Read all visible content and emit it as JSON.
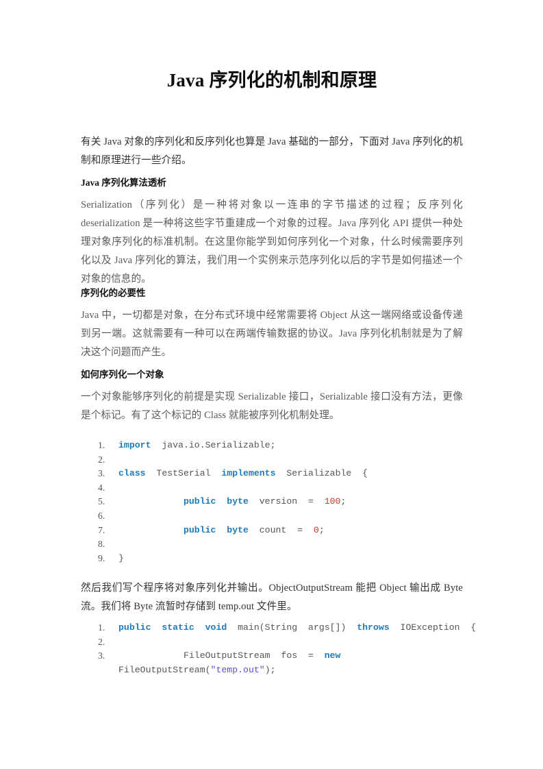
{
  "document": {
    "title": "Java 序列化的机制和原理",
    "intro": "有关 Java 对象的序列化和反序列化也算是 Java 基础的一部分，下面对 Java 序列化的机制和原理进行一些介绍。",
    "sections": [
      {
        "heading": "Java 序列化算法透析",
        "body": "Serialization（序列化）是一种将对象以一连串的字节描述的过程；反序列化 deserialization 是一种将这些字节重建成一个对象的过程。Java 序列化 API 提供一种处理对象序列化的标准机制。在这里你能学到如何序列化一个对象，什么时候需要序列化以及 Java 序列化的算法，我们用一个实例来示范序列化以后的字节是如何描述一个对象的信息的。"
      },
      {
        "heading": "序列化的必要性",
        "body": "Java 中，一切都是对象，在分布式环境中经常需要将 Object 从这一端网络或设备传递到另一端。这就需要有一种可以在两端传输数据的协议。Java 序列化机制就是为了解决这个问题而产生。"
      },
      {
        "heading": "如何序列化一个对象",
        "body": "一个对象能够序列化的前提是实现 Serializable 接口，Serializable 接口没有方法，更像是个标记。有了这个标记的 Class 就能被序列化机制处理。"
      }
    ],
    "paragraph_after_code1": "然后我们写个程序将对象序列化并输出。ObjectOutputStream 能把 Object 输出成 Byte 流。我们将 Byte 流暂时存储到 temp.out 文件里。",
    "code_block_1": {
      "language": "java",
      "lines": [
        {
          "number": 1,
          "tokens": [
            {
              "t": "import",
              "c": "kw"
            },
            {
              "t": "  java.io.Serializable;",
              "c": "plain"
            }
          ]
        },
        {
          "number": 2,
          "tokens": []
        },
        {
          "number": 3,
          "tokens": [
            {
              "t": "class",
              "c": "kw"
            },
            {
              "t": "  TestSerial  ",
              "c": "plain"
            },
            {
              "t": "implements",
              "c": "kw"
            },
            {
              "t": "  Serializable  {",
              "c": "plain"
            }
          ]
        },
        {
          "number": 4,
          "tokens": []
        },
        {
          "number": 5,
          "tokens": [
            {
              "t": "            ",
              "c": "plain"
            },
            {
              "t": "public",
              "c": "kw"
            },
            {
              "t": "  ",
              "c": "plain"
            },
            {
              "t": "byte",
              "c": "kw"
            },
            {
              "t": "  version  =  ",
              "c": "plain"
            },
            {
              "t": "100",
              "c": "num"
            },
            {
              "t": ";",
              "c": "plain"
            }
          ]
        },
        {
          "number": 6,
          "tokens": []
        },
        {
          "number": 7,
          "tokens": [
            {
              "t": "            ",
              "c": "plain"
            },
            {
              "t": "public",
              "c": "kw"
            },
            {
              "t": "  ",
              "c": "plain"
            },
            {
              "t": "byte",
              "c": "kw"
            },
            {
              "t": "  count  =  ",
              "c": "plain"
            },
            {
              "t": "0",
              "c": "num"
            },
            {
              "t": ";",
              "c": "plain"
            }
          ]
        },
        {
          "number": 8,
          "tokens": []
        },
        {
          "number": 9,
          "tokens": [
            {
              "t": "}",
              "c": "plain"
            }
          ]
        }
      ]
    },
    "code_block_2": {
      "language": "java",
      "lines": [
        {
          "number": 1,
          "tokens": [
            {
              "t": "public",
              "c": "kw"
            },
            {
              "t": "  ",
              "c": "plain"
            },
            {
              "t": "static",
              "c": "kw"
            },
            {
              "t": "  ",
              "c": "plain"
            },
            {
              "t": "void",
              "c": "kw"
            },
            {
              "t": "  main(String  args[])  ",
              "c": "plain"
            },
            {
              "t": "throws",
              "c": "kw"
            },
            {
              "t": "  IOException  {",
              "c": "plain"
            }
          ]
        },
        {
          "number": 2,
          "tokens": []
        },
        {
          "number": 3,
          "tokens": [
            {
              "t": "            FileOutputStream  fos  =  ",
              "c": "plain"
            },
            {
              "t": "new",
              "c": "kw"
            },
            {
              "t": "  FileOutputStream(",
              "c": "plain"
            },
            {
              "t": "\"temp.out\"",
              "c": "str"
            },
            {
              "t": ");",
              "c": "plain"
            }
          ]
        }
      ]
    }
  },
  "colors": {
    "keyword": "#1f7bb6",
    "number": "#c0392b",
    "string": "#5b4fd6",
    "body_text": "#5b5b5b",
    "intro_text": "#333333",
    "heading_text": "#141414",
    "page_background": "#ffffff"
  }
}
